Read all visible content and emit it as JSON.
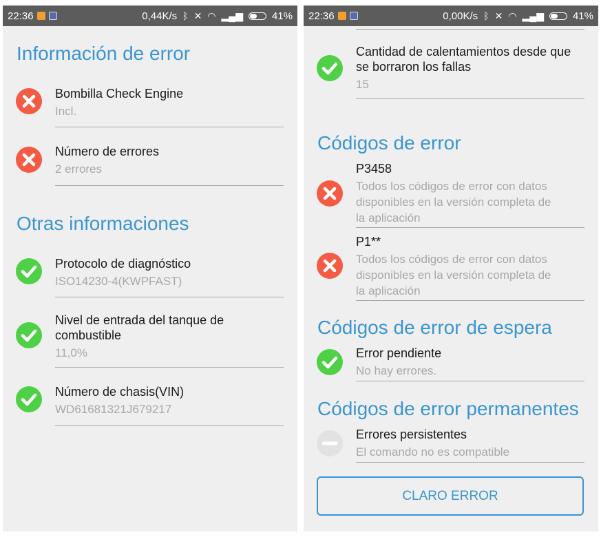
{
  "status_bar_left": {
    "time": "22:36",
    "speed": "0,44K/s",
    "battery": "41%"
  },
  "status_bar_right": {
    "time": "22:36",
    "speed": "0,00K/s",
    "battery": "41%"
  },
  "left": {
    "error_info": {
      "title": "Información de error",
      "items": [
        {
          "label": "Bombilla Check Engine",
          "value": "Incl.",
          "status": "error"
        },
        {
          "label": "Número de errores",
          "value": "2 errores",
          "status": "error"
        }
      ]
    },
    "other_info": {
      "title": "Otras informaciones",
      "items": [
        {
          "label": "Protocolo de diagnóstico",
          "value": "ISO14230-4(KWPFAST)",
          "status": "ok"
        },
        {
          "label_line1": "Nivel de entrada del tanque de",
          "label_line2": "combustible",
          "value": "11,0%",
          "status": "ok"
        },
        {
          "label": "Número de chasis(VIN)",
          "value": "WD61681321J679217",
          "status": "ok"
        }
      ]
    }
  },
  "right": {
    "warmups": {
      "label_line1": "Cantidad de calentamientos desde que",
      "label_line2": "se borraron los fallas",
      "value": "15",
      "status": "ok"
    },
    "error_codes": {
      "title": "Códigos de error",
      "items": [
        {
          "code": "P3458",
          "desc_line1": "Todos los códigos de error con datos",
          "desc_line2": "disponibles en la versión completa de",
          "desc_line3": "la aplicación",
          "status": "error"
        },
        {
          "code": "P1**",
          "desc_line1": "Todos los códigos de error con datos",
          "desc_line2": "disponibles en la versión completa de",
          "desc_line3": "la aplicación",
          "status": "error"
        }
      ]
    },
    "pending_codes": {
      "title": "Códigos de error de espera",
      "item": {
        "label": "Error pendiente",
        "value": "No hay errores.",
        "status": "ok"
      }
    },
    "permanent_codes": {
      "title": "Códigos de error permanentes",
      "item": {
        "label": "Errores persistentes",
        "value": "El comando no es compatible",
        "status": "unsupported"
      }
    },
    "clear_button": "CLARO ERROR"
  },
  "colors": {
    "accent": "#3a95d1",
    "error": "#f45b44",
    "ok": "#4fd046",
    "unsupported": "#e2e2e2",
    "statusbar": "#5c5c5c"
  },
  "icons": {
    "error": "x-circle-icon",
    "ok": "check-circle-icon",
    "unsupported": "minus-circle-icon"
  }
}
